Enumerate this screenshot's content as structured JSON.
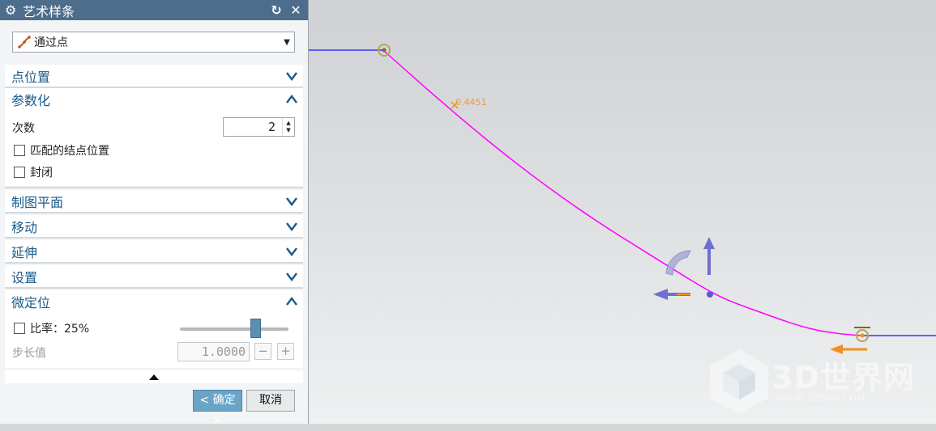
{
  "dialog": {
    "title": "艺术样条",
    "type_select": {
      "value": "通过点"
    },
    "sections": {
      "point_position": "点位置",
      "parameterization": "参数化",
      "drawing_plane": "制图平面",
      "move": "移动",
      "extend": "延伸",
      "settings": "设置",
      "fine_position": "微定位"
    },
    "parameterization": {
      "degree_label": "次数",
      "degree_value": "2",
      "match_knot_label": "匹配的结点位置",
      "match_knot_checked": false,
      "closed_label": "封闭",
      "closed_checked": false
    },
    "fine_position": {
      "ratio_label": "比率：25%",
      "ratio_checked": false,
      "ratio_slider": 0.72,
      "step_label": "步长值",
      "step_value": "1.0000",
      "minus": "−",
      "plus": "+"
    },
    "buttons": {
      "ok": "< 确定 >",
      "cancel": "取消"
    }
  },
  "viewport": {
    "coord_label": "0.4451",
    "watermark": {
      "title": "3D世界网",
      "url": "WWW.3DSJW.COM"
    },
    "colors": {
      "spline": "#ff00ff",
      "reference_line": "#3333ff",
      "handle": "#b9a54a",
      "axis_arrow": "#6f6fd0",
      "orange_arrow": "#f09020"
    }
  }
}
